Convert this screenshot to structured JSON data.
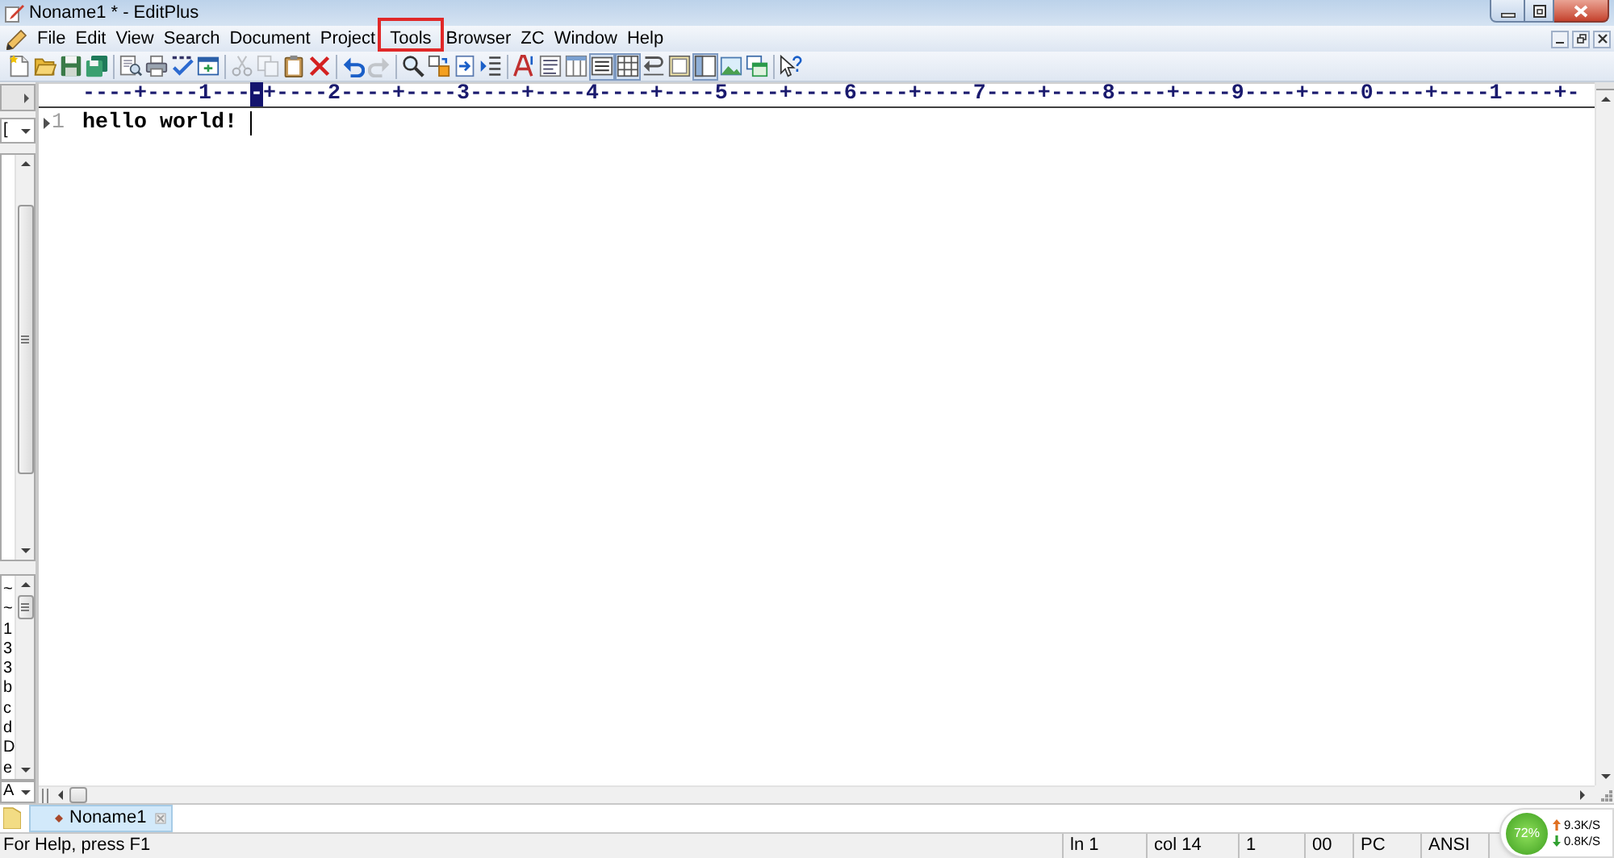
{
  "window": {
    "title": "Noname1 * - EditPlus"
  },
  "menu": [
    {
      "label": "File",
      "highlighted": false
    },
    {
      "label": "Edit",
      "highlighted": false
    },
    {
      "label": "View",
      "highlighted": false
    },
    {
      "label": "Search",
      "highlighted": false
    },
    {
      "label": "Document",
      "highlighted": false
    },
    {
      "label": "Project",
      "highlighted": false
    },
    {
      "label": "Tools",
      "highlighted": true
    },
    {
      "label": "Browser",
      "highlighted": false
    },
    {
      "label": "ZC",
      "highlighted": false
    },
    {
      "label": "Window",
      "highlighted": false
    },
    {
      "label": "Help",
      "highlighted": false
    }
  ],
  "toolbar": [
    {
      "disabled": false,
      "pressed": false
    },
    {
      "disabled": false,
      "pressed": false
    },
    {
      "disabled": false,
      "pressed": false
    },
    {
      "disabled": false,
      "pressed": false
    },
    {
      "disabled": false,
      "pressed": false
    },
    {
      "disabled": false,
      "pressed": false
    },
    {
      "disabled": false,
      "pressed": false
    },
    {
      "disabled": false,
      "pressed": false
    },
    {
      "disabled": true,
      "pressed": false
    },
    {
      "disabled": true,
      "pressed": false
    },
    {
      "disabled": false,
      "pressed": false
    },
    {
      "disabled": false,
      "pressed": false
    },
    {
      "disabled": false,
      "pressed": false
    },
    {
      "disabled": true,
      "pressed": false
    },
    {
      "disabled": false,
      "pressed": false
    },
    {
      "disabled": false,
      "pressed": false
    },
    {
      "disabled": false,
      "pressed": false
    },
    {
      "disabled": false,
      "pressed": false
    },
    {
      "disabled": false,
      "pressed": false
    },
    {
      "disabled": false,
      "pressed": false
    },
    {
      "disabled": false,
      "pressed": false
    },
    {
      "disabled": false,
      "pressed": true
    },
    {
      "disabled": false,
      "pressed": true
    },
    {
      "disabled": false,
      "pressed": false
    },
    {
      "disabled": false,
      "pressed": false
    },
    {
      "disabled": false,
      "pressed": true
    },
    {
      "disabled": false,
      "pressed": false
    },
    {
      "disabled": false,
      "pressed": false
    },
    {
      "disabled": false,
      "pressed": false
    }
  ],
  "side_panel": {
    "top_combo": "[",
    "list_items": [
      "~",
      "~",
      "1",
      "3",
      "3",
      "b",
      "c",
      "d",
      "D",
      "e"
    ],
    "bottom_combo": "A"
  },
  "editor": {
    "ruler": {
      "before_cursor": "----+----1---",
      "at_cursor": "-",
      "after_cursor": "+----2----+----3----+----4----+----5----+----6----+----7----+----8----+----9----+----0----+----1----+-"
    },
    "lines": [
      {
        "number": "1",
        "text": "hello world!",
        "current": true
      }
    ]
  },
  "tabs": [
    {
      "label": "Noname1",
      "selected": true,
      "modified": true
    }
  ],
  "status_bar": {
    "message": "For Help, press F1",
    "panels": [
      "ln 1",
      "col 14",
      "1",
      "00",
      "PC",
      "ANSI"
    ]
  },
  "speed_widget": {
    "percent": "72%",
    "upload": "9.3K/S",
    "download": "0.8K/S"
  }
}
